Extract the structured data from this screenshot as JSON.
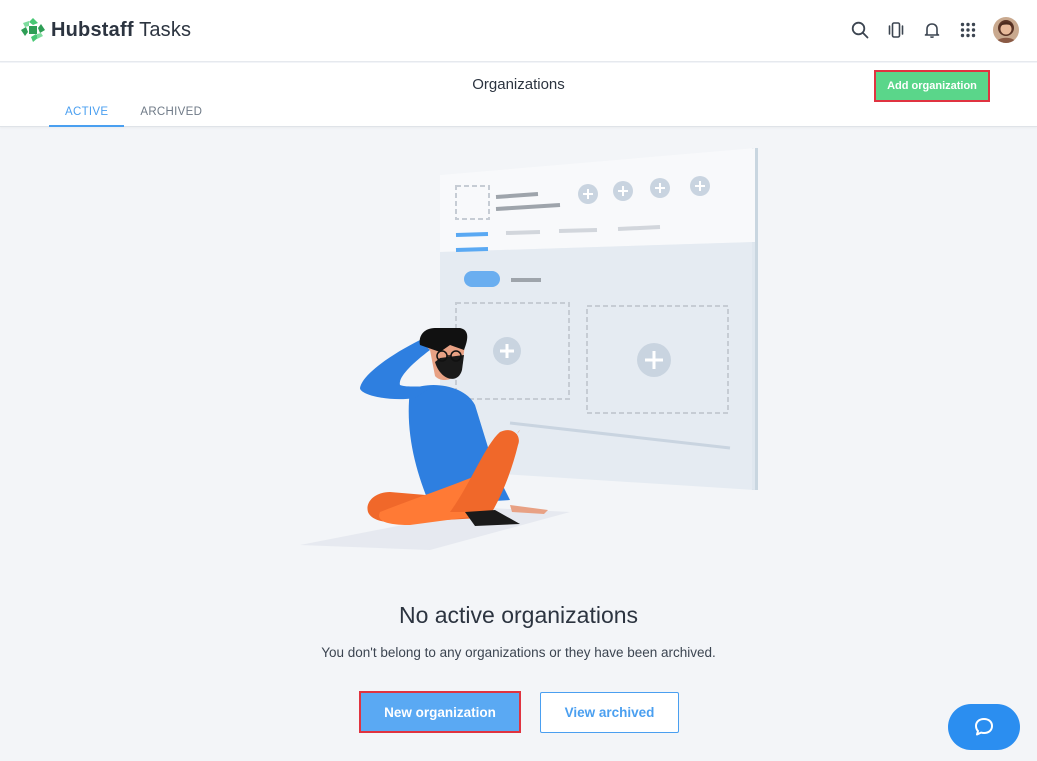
{
  "app": {
    "brand_bold": "Hubstaff",
    "brand_light": " Tasks"
  },
  "topbar": {
    "icons": [
      "search-icon",
      "focus-mode-icon",
      "bell-icon",
      "apps-grid-icon",
      "avatar"
    ]
  },
  "header": {
    "title": "Organizations",
    "add_button": "Add organization"
  },
  "tabs": [
    {
      "label": "ACTIVE",
      "active": true
    },
    {
      "label": "ARCHIVED",
      "active": false
    }
  ],
  "empty_state": {
    "title": "No active organizations",
    "subtitle": "You don't belong to any organizations or they have been archived.",
    "primary_button": "New organization",
    "secondary_button": "View archived"
  },
  "colors": {
    "accent": "#4a9ff0",
    "primary_button": "#5aa9f3",
    "add_button": "#5ad68a",
    "chat": "#2b8ef0",
    "highlight_border": "#e03340"
  }
}
